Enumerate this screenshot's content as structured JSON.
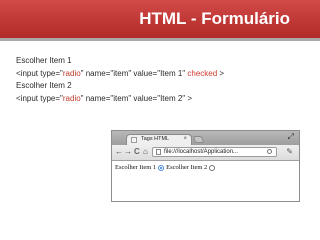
{
  "slide": {
    "title": "HTML - Formulário",
    "lines": [
      {
        "text": "Escolher Item 1"
      },
      {
        "pre": "<input type=\"",
        "type_val": "radio",
        "mid": "\" name=\"item\" value=\"Item 1\" ",
        "checked": "checked",
        "post": " >"
      },
      {
        "text": "Escolher Item 2"
      },
      {
        "pre": "<input type=\"",
        "type_val": "radio",
        "post": "\" name=\"item\" value=\"Item 2\" >"
      }
    ]
  },
  "browser": {
    "tab_title": "Tags HTML",
    "tab_close": "×",
    "url": "file:///localhost/Application...",
    "nav": {
      "back": "←",
      "forward": "→",
      "reload": "C",
      "home": "⌂"
    },
    "wrench": "✎",
    "resize": "⤢",
    "form": {
      "label_1": "Escolher Item 1",
      "label_2": "Escolher Item 2",
      "item1_checked": true,
      "item2_checked": false
    }
  },
  "colors": {
    "title_bar": "#c0392b",
    "highlight": "#c0392b"
  }
}
